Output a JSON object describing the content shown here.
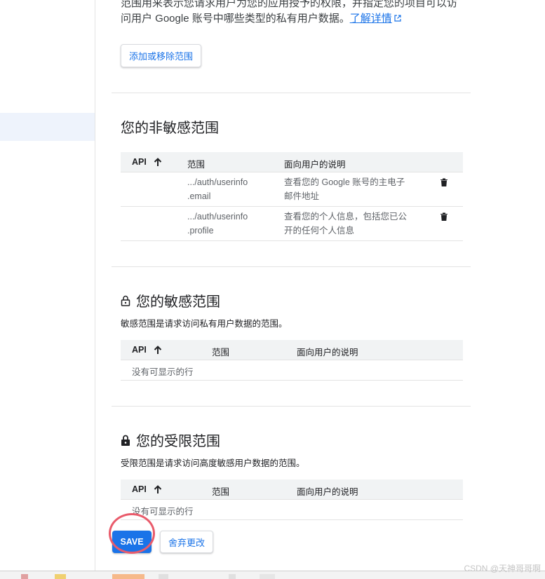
{
  "intro": {
    "line1": "范围用来表示您请求用户为您的应用授予的权限，并指定您的项目可以访",
    "line2": "问用户 Google 账号中哪些类型的私有用户数据。",
    "learn_more": "了解详情"
  },
  "add_remove_button": "添加或移除范围",
  "non_sensitive": {
    "title": "您的非敏感范围",
    "columns": {
      "api": "API",
      "scope": "范围",
      "desc": "面向用户的说明"
    },
    "rows": [
      {
        "scope1": ".../auth/userinfo",
        "scope2": ".email",
        "desc1": "查看您的 Google 账号的主电子",
        "desc2": "邮件地址"
      },
      {
        "scope1": ".../auth/userinfo",
        "scope2": ".profile",
        "desc1": "查看您的个人信息，包括您已公",
        "desc2": "开的任何个人信息"
      }
    ]
  },
  "sensitive": {
    "title": "您的敏感范围",
    "description": "敏感范围是请求访问私有用户数据的范围。",
    "columns": {
      "api": "API",
      "scope": "范围",
      "desc": "面向用户的说明"
    },
    "empty": "没有可显示的行"
  },
  "restricted": {
    "title": "您的受限范围",
    "description": "受限范围是请求访问高度敏感用户数据的范围。",
    "columns": {
      "api": "API",
      "scope": "范围",
      "desc": "面向用户的说明"
    },
    "empty": "没有可显示的行"
  },
  "actions": {
    "save": "SAVE",
    "discard": "舍弃更改"
  },
  "watermark": "CSDN @天神哥哥啊",
  "colors": {
    "accent": "#1a73e8",
    "highlight_circle": "#e95b6b"
  }
}
